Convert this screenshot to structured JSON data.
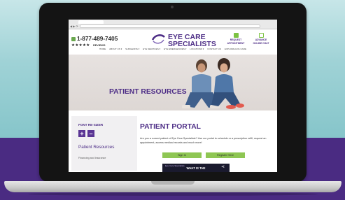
{
  "browser": {
    "url": "",
    "nav_icons": "◀ ▶ ⟳"
  },
  "header": {
    "phone": "1-877-489-7405",
    "stars": "★★★★★",
    "reviews_label": "REVIEWS",
    "logo_line1": "EYE CARE",
    "logo_line2": "SPECIALISTS",
    "request_label_1": "REQUEST",
    "request_label_2": "APPOINTMENT",
    "portal_label_1": "ADVANCE",
    "portal_label_2": "ONLINE CHAT"
  },
  "nav": {
    "items": [
      "HOME",
      "ABOUT US ▾",
      "SURGEONS ▾",
      "EYE SERVICES ▾",
      "EYE EMERGENCIES ▾",
      "LOCATIONS ▾",
      "CONTACT US",
      "EXPLORE EYE CARE"
    ]
  },
  "hero": {
    "title": "PATIENT RESOURCES"
  },
  "sidebar": {
    "font_resizer_label": "FONT RE-SIZER",
    "increase_label": "+",
    "decrease_label": "–",
    "heading": "Patient Resources",
    "link_financing": "Financing and Insurance"
  },
  "main": {
    "title": "PATIENT PORTAL",
    "intro": "Are you a current patient of Eye Care Specialists? Use our portal to schedule or a prescription refill, request an appointment, access medical records and much more!",
    "sign_in_label": "Sign In",
    "register_label": "Register Here"
  },
  "video": {
    "title": "WHAT IS THE",
    "brand": "Eye Care Specialists",
    "share_icon": "share-icon"
  },
  "colors": {
    "brand_purple": "#4d2d86",
    "accent_green": "#8ec653",
    "background_teal": "#9fd2d6",
    "background_purple": "#4a2b82"
  }
}
